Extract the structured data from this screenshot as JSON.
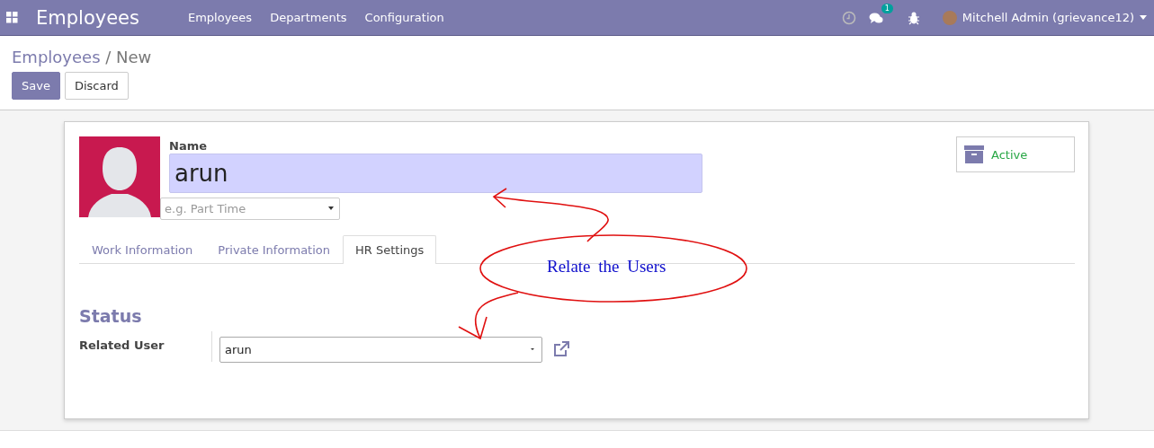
{
  "navbar": {
    "app_title": "Employees",
    "menu": [
      {
        "label": "Employees"
      },
      {
        "label": "Departments"
      },
      {
        "label": "Configuration"
      }
    ],
    "messages_badge": "1",
    "user": "Mitchell Admin (grievance12)"
  },
  "breadcrumb": {
    "parent": "Employees",
    "separator": "/",
    "current": "New"
  },
  "buttons": [
    {
      "label": "Save",
      "kind": "primary"
    },
    {
      "label": "Discard",
      "kind": "secondary"
    }
  ],
  "form": {
    "name_label": "Name",
    "name_value": "arun",
    "job_placeholder": "e.g. Part Time",
    "active_label": "Active",
    "tabs": [
      {
        "label": "Work Information",
        "selected": false
      },
      {
        "label": "Private Information",
        "selected": false
      },
      {
        "label": "HR Settings",
        "selected": true
      }
    ],
    "section_title": "Status",
    "related_user_label": "Related User",
    "related_user_value": "arun"
  },
  "annotation": {
    "text": "Relate the Users"
  }
}
